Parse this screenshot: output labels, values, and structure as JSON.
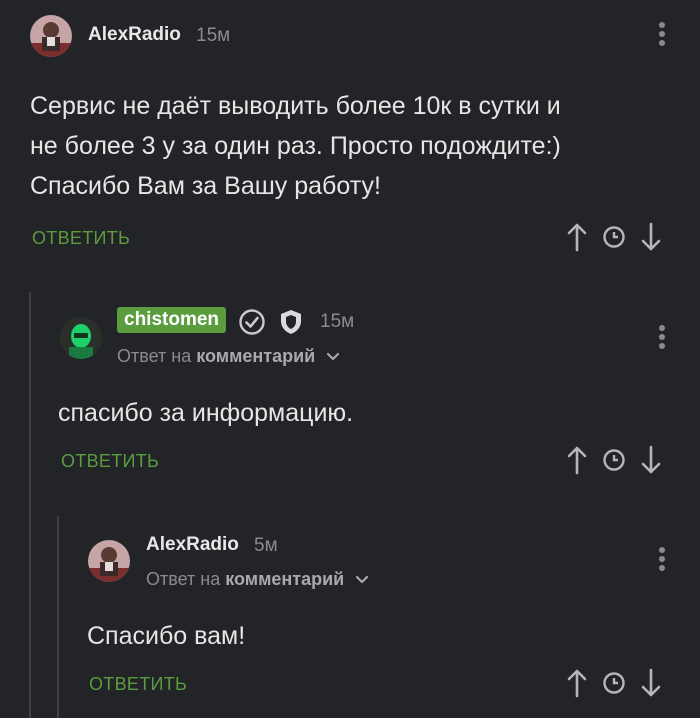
{
  "comments": [
    {
      "username": "AlexRadio",
      "time": "15м",
      "text_lines": [
        "Сервис не даёт выводить более 10к в сутки и",
        "не более 3 у за один раз. Просто подождите:)",
        "Спасибо Вам за Вашу работу!"
      ],
      "reply_label": "ОТВЕТИТЬ"
    },
    {
      "username": "chistomen",
      "time": "15м",
      "reply_to_prefix": "Ответ на",
      "reply_to_target": "комментарий",
      "text": "спасибо за информацию.",
      "reply_label": "ОТВЕТИТЬ"
    },
    {
      "username": "AlexRadio",
      "time": "5м",
      "reply_to_prefix": "Ответ на",
      "reply_to_target": "комментарий",
      "text": "Спасибо вам!",
      "reply_label": "ОТВЕТИТЬ"
    }
  ],
  "colors": {
    "background": "#232427",
    "accent_green": "#5b9c3f",
    "muted": "#8a8b8f"
  },
  "icons": [
    "more-vertical-icon",
    "arrow-up-icon",
    "clock-icon",
    "arrow-down-icon",
    "verified-check-icon",
    "shield-icon",
    "chevron-down-icon"
  ]
}
